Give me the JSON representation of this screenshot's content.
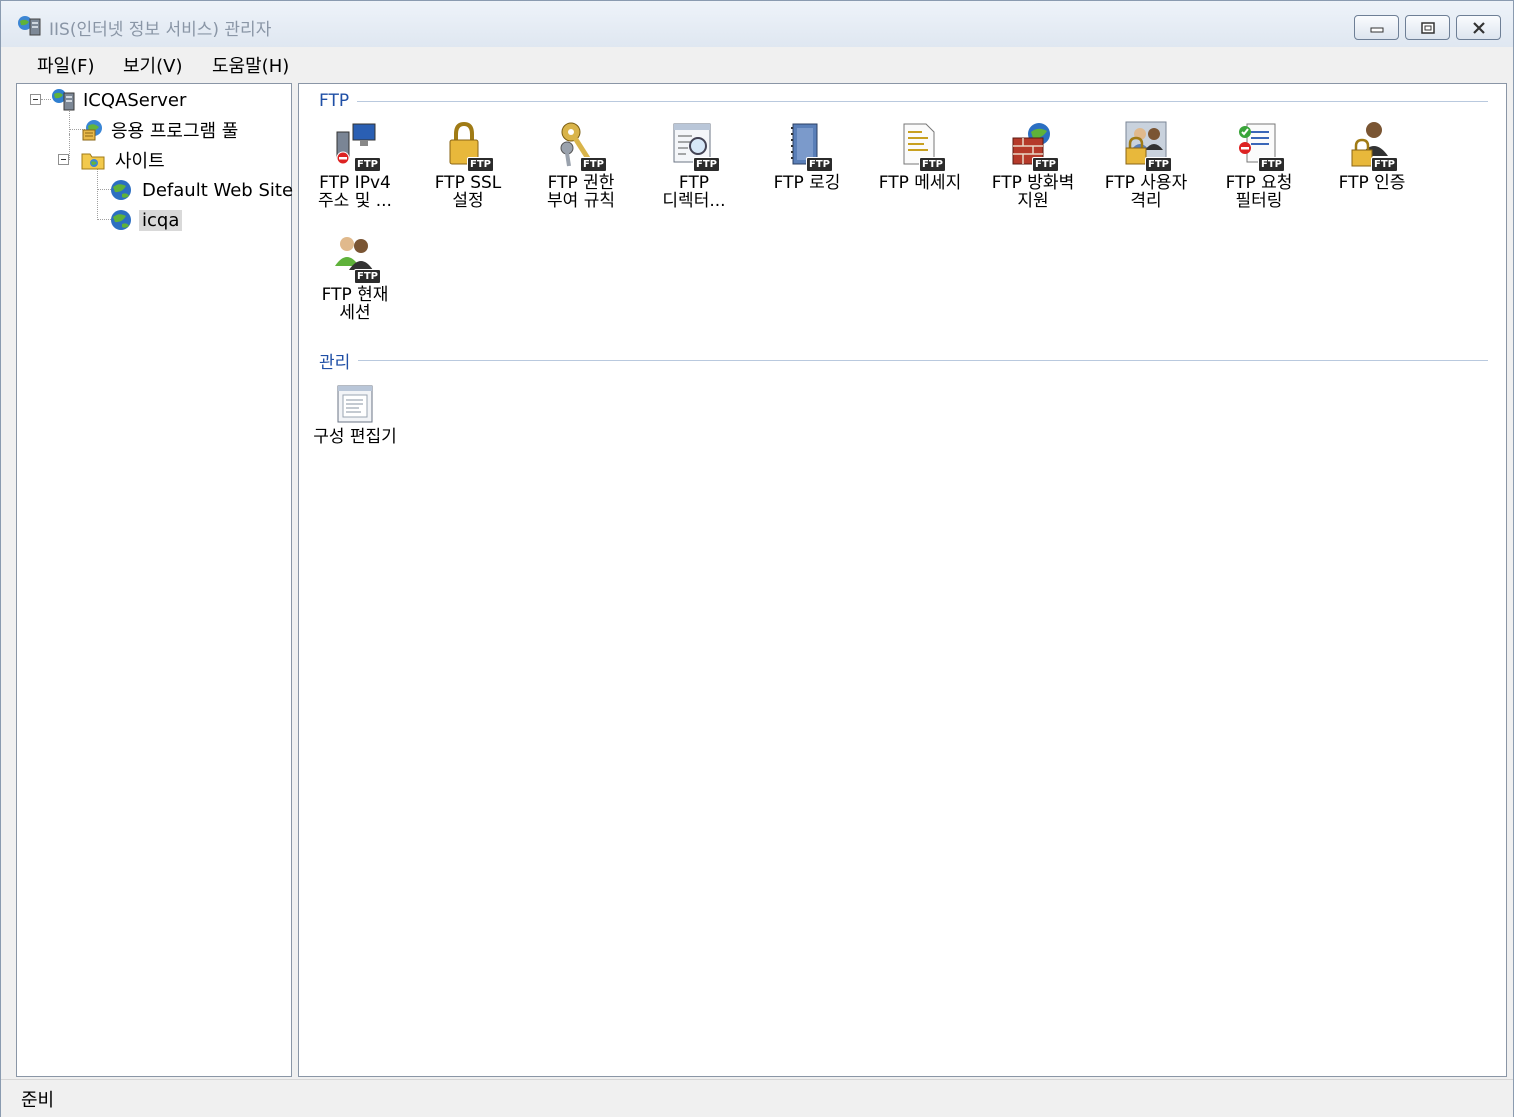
{
  "window": {
    "title": "IIS(인터넷 정보 서비스) 관리자"
  },
  "menu": {
    "items": [
      "파일(F)",
      "보기(V)",
      "도움말(H)"
    ]
  },
  "tree": {
    "server": "ICQAServer",
    "app_pools": "응용 프로그램 풀",
    "sites": "사이트",
    "site1": "Default Web Site",
    "site2": "icqa"
  },
  "groups": {
    "ftp": {
      "title": "FTP",
      "items": [
        {
          "label": "FTP IPv4\n주소 및 ...",
          "icon": "ipv4-icon"
        },
        {
          "label": "FTP SSL\n설정",
          "icon": "lock-icon"
        },
        {
          "label": "FTP 권한\n부여 규칙",
          "icon": "key-icon"
        },
        {
          "label": "FTP\n디렉터...",
          "icon": "directory-browse-icon"
        },
        {
          "label": "FTP 로깅",
          "icon": "log-icon"
        },
        {
          "label": "FTP 메세지",
          "icon": "message-icon"
        },
        {
          "label": "FTP 방화벽\n지원",
          "icon": "firewall-icon"
        },
        {
          "label": "FTP 사용자\n격리",
          "icon": "user-isolation-icon"
        },
        {
          "label": "FTP 요청\n필터링",
          "icon": "request-filter-icon"
        },
        {
          "label": "FTP 인증",
          "icon": "authentication-icon"
        },
        {
          "label": "FTP 현재\n세션",
          "icon": "sessions-icon"
        }
      ]
    },
    "management": {
      "title": "관리",
      "items": [
        {
          "label": "구성 편집기",
          "icon": "config-editor-icon"
        }
      ]
    }
  },
  "badge": "FTP",
  "status": {
    "text": "준비"
  }
}
